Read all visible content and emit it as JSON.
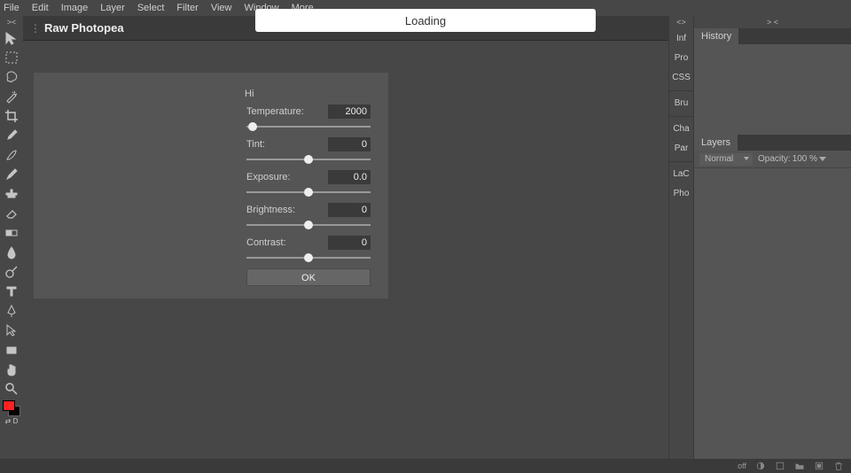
{
  "menu": {
    "items": [
      "File",
      "Edit",
      "Image",
      "Layer",
      "Select",
      "Filter",
      "View",
      "Window",
      "More"
    ]
  },
  "document": {
    "title": "Raw Photopea"
  },
  "loading": {
    "label": "Loading"
  },
  "dialog": {
    "greet": "Hi",
    "temperature": {
      "label": "Temperature:",
      "value": "2000",
      "pos": 0.05
    },
    "tint": {
      "label": "Tint:",
      "value": "0",
      "pos": 0.5
    },
    "exposure": {
      "label": "Exposure:",
      "value": "0.0",
      "pos": 0.5
    },
    "brightness": {
      "label": "Brightness:",
      "value": "0",
      "pos": 0.5
    },
    "contrast": {
      "label": "Contrast:",
      "value": "0",
      "pos": 0.5
    },
    "ok_label": "OK"
  },
  "right_tabs": {
    "group1": [
      "Inf",
      "Pro",
      "CSS"
    ],
    "group2": [
      "Bru"
    ],
    "group3": [
      "Cha",
      "Par"
    ],
    "group4": [
      "LaC",
      "Pho"
    ]
  },
  "history_panel": {
    "tab": "History"
  },
  "layers_panel": {
    "tab": "Layers",
    "blend_mode": "Normal",
    "opacity_label": "Opacity:",
    "opacity_value": "100 %"
  },
  "status": {
    "left": "off"
  },
  "collapse_marks": {
    "left": "><",
    "mid": "<>",
    "right": "> <"
  }
}
